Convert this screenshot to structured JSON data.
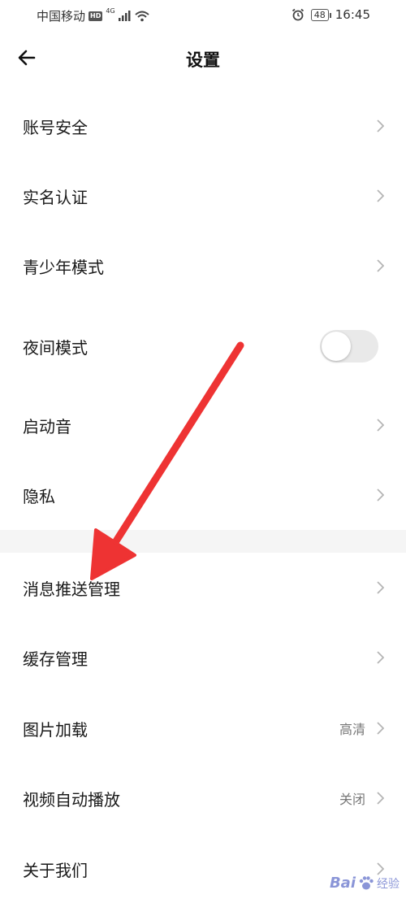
{
  "status_bar": {
    "carrier": "中国移动",
    "hd": "HD",
    "network": "4G",
    "battery": "48",
    "time": "16:45"
  },
  "nav": {
    "title": "设置"
  },
  "rows": [
    {
      "label": "账号安全"
    },
    {
      "label": "实名认证"
    },
    {
      "label": "青少年模式"
    },
    {
      "label": "夜间模式",
      "toggle": false
    },
    {
      "label": "启动音"
    },
    {
      "label": "隐私"
    },
    {
      "label": "消息推送管理"
    },
    {
      "label": "缓存管理"
    },
    {
      "label": "图片加载",
      "value": "高清"
    },
    {
      "label": "视频自动播放",
      "value": "关闭"
    },
    {
      "label": "关于我们"
    }
  ],
  "watermark": {
    "brand": "Bai",
    "suffix": "经验"
  },
  "colors": {
    "annotation_arrow": "#ee3333",
    "toggle_track": "#e9e9e9",
    "section_gap": "#f5f5f5"
  }
}
